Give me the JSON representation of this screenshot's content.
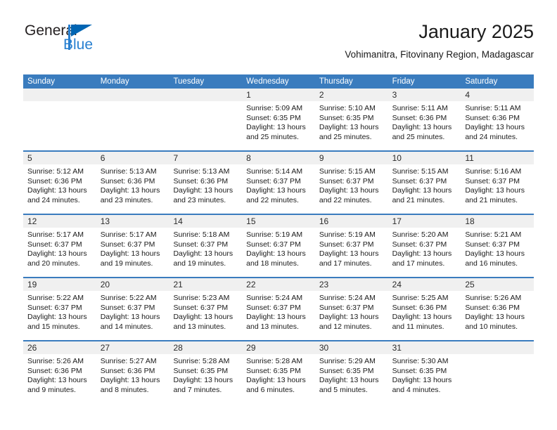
{
  "brand": {
    "name_part1": "General",
    "name_part2": "Blue",
    "accent_color": "#0065b3",
    "secondary_color": "#2980d0"
  },
  "header": {
    "title": "January 2025",
    "subtitle": "Vohimanitra, Fitovinany Region, Madagascar"
  },
  "calendar": {
    "header_bg": "#3a7cbe",
    "daynum_bg": "#f0f0f0",
    "weekdays": [
      "Sunday",
      "Monday",
      "Tuesday",
      "Wednesday",
      "Thursday",
      "Friday",
      "Saturday"
    ],
    "weeks": [
      [
        {
          "day": "",
          "lines": []
        },
        {
          "day": "",
          "lines": []
        },
        {
          "day": "",
          "lines": []
        },
        {
          "day": "1",
          "lines": [
            "Sunrise: 5:09 AM",
            "Sunset: 6:35 PM",
            "Daylight: 13 hours",
            "and 25 minutes."
          ]
        },
        {
          "day": "2",
          "lines": [
            "Sunrise: 5:10 AM",
            "Sunset: 6:35 PM",
            "Daylight: 13 hours",
            "and 25 minutes."
          ]
        },
        {
          "day": "3",
          "lines": [
            "Sunrise: 5:11 AM",
            "Sunset: 6:36 PM",
            "Daylight: 13 hours",
            "and 25 minutes."
          ]
        },
        {
          "day": "4",
          "lines": [
            "Sunrise: 5:11 AM",
            "Sunset: 6:36 PM",
            "Daylight: 13 hours",
            "and 24 minutes."
          ]
        }
      ],
      [
        {
          "day": "5",
          "lines": [
            "Sunrise: 5:12 AM",
            "Sunset: 6:36 PM",
            "Daylight: 13 hours",
            "and 24 minutes."
          ]
        },
        {
          "day": "6",
          "lines": [
            "Sunrise: 5:13 AM",
            "Sunset: 6:36 PM",
            "Daylight: 13 hours",
            "and 23 minutes."
          ]
        },
        {
          "day": "7",
          "lines": [
            "Sunrise: 5:13 AM",
            "Sunset: 6:36 PM",
            "Daylight: 13 hours",
            "and 23 minutes."
          ]
        },
        {
          "day": "8",
          "lines": [
            "Sunrise: 5:14 AM",
            "Sunset: 6:37 PM",
            "Daylight: 13 hours",
            "and 22 minutes."
          ]
        },
        {
          "day": "9",
          "lines": [
            "Sunrise: 5:15 AM",
            "Sunset: 6:37 PM",
            "Daylight: 13 hours",
            "and 22 minutes."
          ]
        },
        {
          "day": "10",
          "lines": [
            "Sunrise: 5:15 AM",
            "Sunset: 6:37 PM",
            "Daylight: 13 hours",
            "and 21 minutes."
          ]
        },
        {
          "day": "11",
          "lines": [
            "Sunrise: 5:16 AM",
            "Sunset: 6:37 PM",
            "Daylight: 13 hours",
            "and 21 minutes."
          ]
        }
      ],
      [
        {
          "day": "12",
          "lines": [
            "Sunrise: 5:17 AM",
            "Sunset: 6:37 PM",
            "Daylight: 13 hours",
            "and 20 minutes."
          ]
        },
        {
          "day": "13",
          "lines": [
            "Sunrise: 5:17 AM",
            "Sunset: 6:37 PM",
            "Daylight: 13 hours",
            "and 19 minutes."
          ]
        },
        {
          "day": "14",
          "lines": [
            "Sunrise: 5:18 AM",
            "Sunset: 6:37 PM",
            "Daylight: 13 hours",
            "and 19 minutes."
          ]
        },
        {
          "day": "15",
          "lines": [
            "Sunrise: 5:19 AM",
            "Sunset: 6:37 PM",
            "Daylight: 13 hours",
            "and 18 minutes."
          ]
        },
        {
          "day": "16",
          "lines": [
            "Sunrise: 5:19 AM",
            "Sunset: 6:37 PM",
            "Daylight: 13 hours",
            "and 17 minutes."
          ]
        },
        {
          "day": "17",
          "lines": [
            "Sunrise: 5:20 AM",
            "Sunset: 6:37 PM",
            "Daylight: 13 hours",
            "and 17 minutes."
          ]
        },
        {
          "day": "18",
          "lines": [
            "Sunrise: 5:21 AM",
            "Sunset: 6:37 PM",
            "Daylight: 13 hours",
            "and 16 minutes."
          ]
        }
      ],
      [
        {
          "day": "19",
          "lines": [
            "Sunrise: 5:22 AM",
            "Sunset: 6:37 PM",
            "Daylight: 13 hours",
            "and 15 minutes."
          ]
        },
        {
          "day": "20",
          "lines": [
            "Sunrise: 5:22 AM",
            "Sunset: 6:37 PM",
            "Daylight: 13 hours",
            "and 14 minutes."
          ]
        },
        {
          "day": "21",
          "lines": [
            "Sunrise: 5:23 AM",
            "Sunset: 6:37 PM",
            "Daylight: 13 hours",
            "and 13 minutes."
          ]
        },
        {
          "day": "22",
          "lines": [
            "Sunrise: 5:24 AM",
            "Sunset: 6:37 PM",
            "Daylight: 13 hours",
            "and 13 minutes."
          ]
        },
        {
          "day": "23",
          "lines": [
            "Sunrise: 5:24 AM",
            "Sunset: 6:37 PM",
            "Daylight: 13 hours",
            "and 12 minutes."
          ]
        },
        {
          "day": "24",
          "lines": [
            "Sunrise: 5:25 AM",
            "Sunset: 6:36 PM",
            "Daylight: 13 hours",
            "and 11 minutes."
          ]
        },
        {
          "day": "25",
          "lines": [
            "Sunrise: 5:26 AM",
            "Sunset: 6:36 PM",
            "Daylight: 13 hours",
            "and 10 minutes."
          ]
        }
      ],
      [
        {
          "day": "26",
          "lines": [
            "Sunrise: 5:26 AM",
            "Sunset: 6:36 PM",
            "Daylight: 13 hours",
            "and 9 minutes."
          ]
        },
        {
          "day": "27",
          "lines": [
            "Sunrise: 5:27 AM",
            "Sunset: 6:36 PM",
            "Daylight: 13 hours",
            "and 8 minutes."
          ]
        },
        {
          "day": "28",
          "lines": [
            "Sunrise: 5:28 AM",
            "Sunset: 6:35 PM",
            "Daylight: 13 hours",
            "and 7 minutes."
          ]
        },
        {
          "day": "29",
          "lines": [
            "Sunrise: 5:28 AM",
            "Sunset: 6:35 PM",
            "Daylight: 13 hours",
            "and 6 minutes."
          ]
        },
        {
          "day": "30",
          "lines": [
            "Sunrise: 5:29 AM",
            "Sunset: 6:35 PM",
            "Daylight: 13 hours",
            "and 5 minutes."
          ]
        },
        {
          "day": "31",
          "lines": [
            "Sunrise: 5:30 AM",
            "Sunset: 6:35 PM",
            "Daylight: 13 hours",
            "and 4 minutes."
          ]
        },
        {
          "day": "",
          "lines": []
        }
      ]
    ]
  }
}
